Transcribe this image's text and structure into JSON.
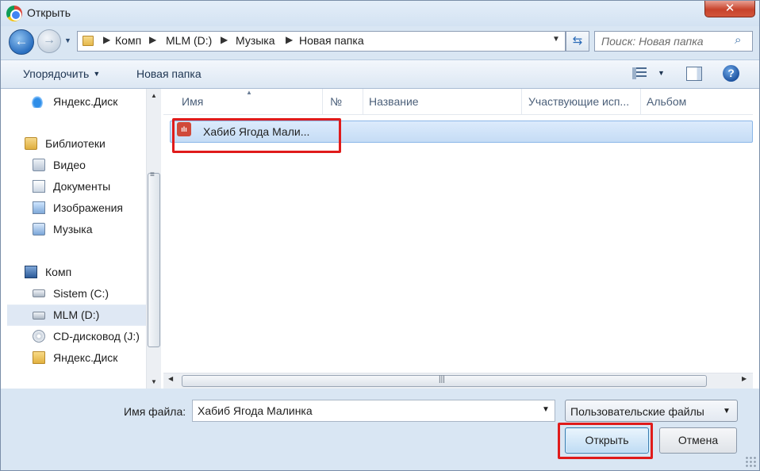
{
  "window": {
    "title": "Открыть",
    "close_label": "✕"
  },
  "nav": {
    "back_icon": "back-arrow-icon",
    "forward_icon": "forward-arrow-icon"
  },
  "address": {
    "crumbs": [
      "Комп",
      "MLM (D:)",
      "Музыка",
      "Новая папка"
    ],
    "separator": "▶"
  },
  "search": {
    "placeholder": "Поиск: Новая папка"
  },
  "toolbar": {
    "organize_label": "Упорядочить",
    "new_folder_label": "Новая папка"
  },
  "sidebar": {
    "items": [
      {
        "label": "Яндекс.Диск",
        "icon": "yandex-disk-icon"
      },
      {
        "label": "Библиотеки",
        "icon": "libraries-icon"
      },
      {
        "label": "Видео",
        "icon": "video-library-icon"
      },
      {
        "label": "Документы",
        "icon": "documents-library-icon"
      },
      {
        "label": "Изображения",
        "icon": "pictures-library-icon"
      },
      {
        "label": "Музыка",
        "icon": "music-library-icon"
      },
      {
        "label": "Комп",
        "icon": "computer-icon"
      },
      {
        "label": "Sistem (C:)",
        "icon": "drive-icon"
      },
      {
        "label": "MLM (D:)",
        "icon": "drive-icon",
        "selected": true
      },
      {
        "label": "CD-дисковод (J:)",
        "icon": "cd-drive-icon"
      },
      {
        "label": "Яндекс.Диск",
        "icon": "yandex-folder-icon"
      }
    ]
  },
  "file_list": {
    "columns": [
      "Имя",
      "№",
      "Название",
      "Участвующие исп...",
      "Альбом"
    ],
    "files": [
      {
        "name": "Хабиб Ягода Мали...",
        "icon": "audio-file-icon",
        "selected": true
      }
    ]
  },
  "footer": {
    "filename_label": "Имя файла:",
    "filename_value": "Хабиб Ягода Малинка",
    "filter_value": "Пользовательские файлы",
    "open_label": "Открыть",
    "cancel_label": "Отмена"
  },
  "colors": {
    "highlight": "#e01b1b",
    "selection": "#c5dcf5",
    "accent": "#2a6fc0"
  }
}
